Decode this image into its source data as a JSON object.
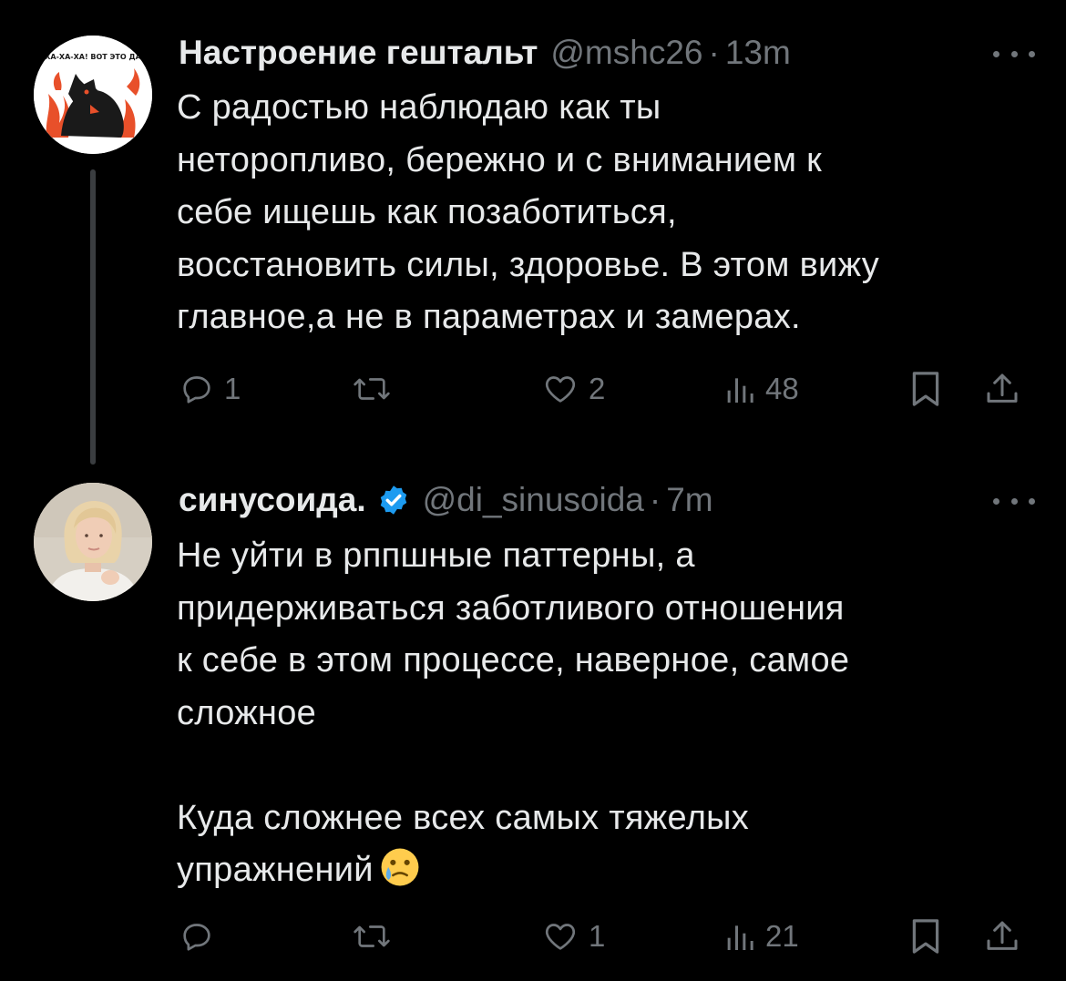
{
  "tweets": [
    {
      "display_name": "Настроение гештальт",
      "handle": "@mshc26",
      "separator": "·",
      "time": "13m",
      "text_lines": [
        "С радостью наблюдаю как ты",
        "неторопливо, бережно и с вниманием к",
        "себе ищешь как позаботиться,",
        "восстановить силы, здоровье. В этом вижу",
        "главное,а не в параметрах и замерах."
      ],
      "avatar_text": "ХА-ХА-ХА! ВОТ ЭТО ДА",
      "avatar_icon": "black-wolf-on-fire-drawing",
      "actions": {
        "reply_count": "1",
        "retweet_count": "",
        "like_count": "2",
        "views_count": "48"
      }
    },
    {
      "display_name": "синусоида.",
      "verified": true,
      "handle": "@di_sinusoida",
      "separator": "·",
      "time": "7m",
      "text_lines": [
        "Не уйти в рппшные паттерны, а",
        "придерживаться заботливого отношения",
        "к себе в этом процессе, наверное, самое",
        "сложное"
      ],
      "text_lines_2": [
        "Куда сложнее всех самых тяжелых",
        "упражнений"
      ],
      "emoji": "crying-face-emoji",
      "avatar_icon": "blonde-woman-photo",
      "actions": {
        "reply_count": "",
        "retweet_count": "",
        "like_count": "1",
        "views_count": "21"
      }
    }
  ],
  "colors": {
    "background": "#000000",
    "text": "#e7e9ea",
    "secondary": "#71767b",
    "verified": "#1d9bf0",
    "thread_line": "#3a3d40"
  }
}
